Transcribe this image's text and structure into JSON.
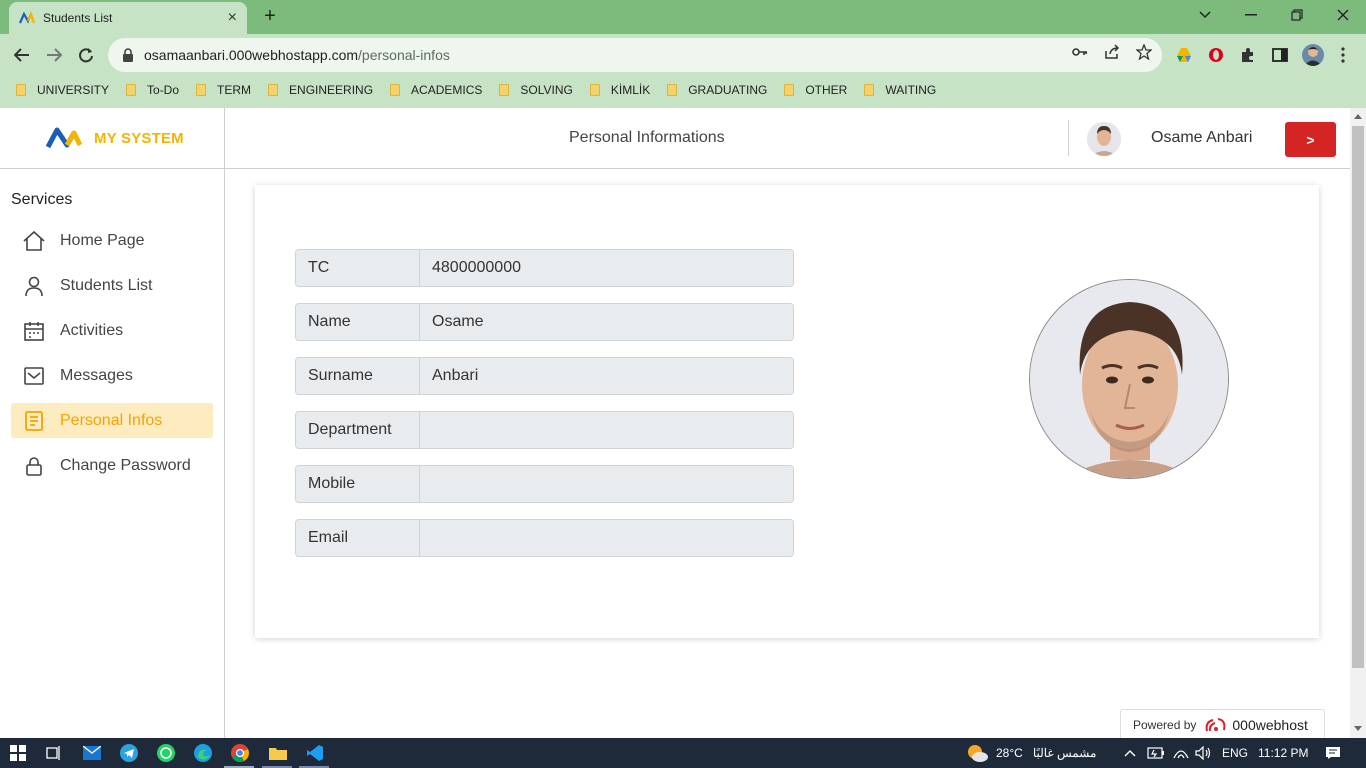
{
  "browser": {
    "tab_title": "Students List",
    "close_tab": "×",
    "new_tab": "+",
    "url_host": "osamaanbari.000webhostapp.com",
    "url_path": "/personal-infos",
    "bookmarks": [
      "UNIVERSITY",
      "To-Do",
      "TERM",
      "ENGINEERING",
      "ACADEMICS",
      "SOLVING",
      "KİMLİK",
      "GRADUATING",
      "OTHER",
      "WAITING"
    ]
  },
  "app": {
    "logo_text": "MY SYSTEM",
    "header_title": "Personal Informations",
    "user_name": "Osame Anbari",
    "logout_label": ">",
    "services_heading": "Services",
    "menu": [
      {
        "label": "Home Page",
        "icon": "home-icon"
      },
      {
        "label": "Students List",
        "icon": "user-icon"
      },
      {
        "label": "Activities",
        "icon": "calendar-icon"
      },
      {
        "label": "Messages",
        "icon": "mail-icon"
      },
      {
        "label": "Personal Infos",
        "icon": "document-icon",
        "active": true
      },
      {
        "label": "Change Password",
        "icon": "lock-icon"
      }
    ],
    "info_rows": [
      {
        "label": "TC",
        "value": "4800000000"
      },
      {
        "label": "Name",
        "value": "Osame"
      },
      {
        "label": "Surname",
        "value": "Anbari"
      },
      {
        "label": "Department",
        "value": ""
      },
      {
        "label": "Mobile",
        "value": ""
      },
      {
        "label": "Email",
        "value": ""
      }
    ],
    "powered_by": "Powered by",
    "powered_brand": "000webhost"
  },
  "taskbar": {
    "weather_temp": "28°C",
    "weather_desc": "مشمس غالبًا",
    "language": "ENG",
    "time": "11:12 PM"
  },
  "colors": {
    "accent": "#f5a300",
    "active_bg": "#fdecc0",
    "logout": "#d42424",
    "chrome": "#c6e3c6",
    "tabstrip": "#7dbb7d"
  }
}
